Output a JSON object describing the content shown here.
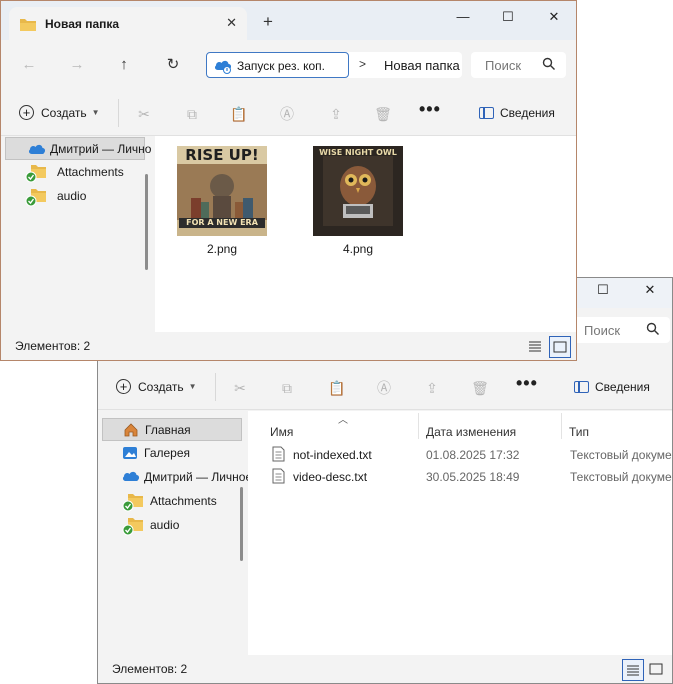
{
  "back_window": {
    "window_controls": {
      "maximize": "☐",
      "close": "✕"
    },
    "search_placeholder": "Поиск",
    "toolbar": {
      "create_label": "Создать",
      "details_label": "Сведения",
      "more_label": "•••"
    },
    "sidebar": {
      "items": [
        {
          "label": "Главная",
          "icon": "home-icon",
          "selected": true
        },
        {
          "label": "Галерея",
          "icon": "gallery-icon",
          "selected": false
        },
        {
          "label": "Дмитрий — Личное",
          "icon": "cloud-icon",
          "selected": false
        },
        {
          "label": "Attachments",
          "icon": "synced-folder-icon",
          "selected": false
        },
        {
          "label": "audio",
          "icon": "synced-folder-icon",
          "selected": false
        }
      ]
    },
    "columns": {
      "name": "Имя",
      "date": "Дата изменения",
      "type": "Тип"
    },
    "files": [
      {
        "name": "not-indexed.txt",
        "date": "01.08.2025 17:32",
        "type": "Текстовый документ"
      },
      {
        "name": "video-desc.txt",
        "date": "30.05.2025 18:49",
        "type": "Текстовый документ"
      }
    ],
    "status": "Элементов: 2"
  },
  "front_window": {
    "tab_title": "Новая папка",
    "tab_close": "✕",
    "new_tab": "+",
    "window_controls": {
      "minimize": "—",
      "maximize": "☐",
      "close": "✕"
    },
    "nav_icons": {
      "back": "←",
      "forward": "→",
      "up": "↑",
      "refresh": "↻"
    },
    "address": {
      "crumb1": "Запуск рез. коп.",
      "separator": ">",
      "crumb2": "Новая папка"
    },
    "search_placeholder": "Поиск",
    "toolbar": {
      "create_label": "Создать",
      "details_label": "Сведения",
      "more_label": "•••"
    },
    "sidebar": {
      "items": [
        {
          "label": "Дмитрий — Личное",
          "icon": "cloud-icon",
          "selected": true
        },
        {
          "label": "Attachments",
          "icon": "synced-folder-icon",
          "selected": false
        },
        {
          "label": "audio",
          "icon": "synced-folder-icon",
          "selected": false
        }
      ]
    },
    "thumbnails": [
      {
        "name": "2.png",
        "poster_top": "RISE UP!",
        "poster_bottom": "FOR A NEW ERA"
      },
      {
        "name": "4.png",
        "poster_top": "WISE NIGHT OWL",
        "poster_bottom": ""
      }
    ],
    "status": "Элементов: 2"
  },
  "colors": {
    "accent": "#2f63b8",
    "folder": "#e8b84a",
    "sync_check": "#3a9b3a",
    "cloud": "#2e7fd6"
  }
}
